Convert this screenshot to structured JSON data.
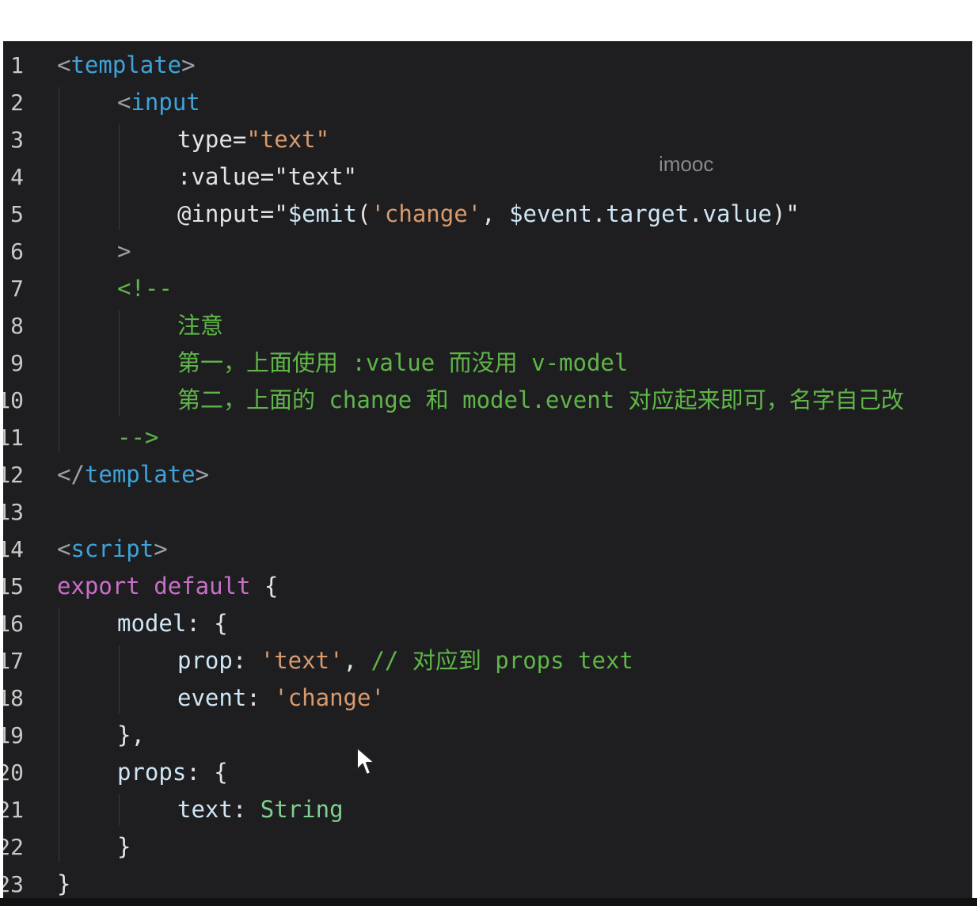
{
  "watermark": "imooc",
  "lines": [
    {
      "num": "1",
      "indent": 0,
      "tokens": [
        {
          "t": "<",
          "c": "punct"
        },
        {
          "t": "template",
          "c": "tag"
        },
        {
          "t": ">",
          "c": "punct"
        }
      ]
    },
    {
      "num": "2",
      "indent": 1,
      "tokens": [
        {
          "t": "<",
          "c": "punct"
        },
        {
          "t": "input",
          "c": "tag"
        }
      ]
    },
    {
      "num": "3",
      "indent": 2,
      "tokens": [
        {
          "t": "type",
          "c": "attr"
        },
        {
          "t": "=",
          "c": "plain"
        },
        {
          "t": "\"text\"",
          "c": "str"
        }
      ]
    },
    {
      "num": "4",
      "indent": 2,
      "tokens": [
        {
          "t": ":value",
          "c": "attr"
        },
        {
          "t": "=",
          "c": "plain"
        },
        {
          "t": "\"text\"",
          "c": "strw"
        }
      ]
    },
    {
      "num": "5",
      "indent": 2,
      "tokens": [
        {
          "t": "@input",
          "c": "attr"
        },
        {
          "t": "=\"",
          "c": "plain"
        },
        {
          "t": "$emit",
          "c": "prop"
        },
        {
          "t": "(",
          "c": "plain"
        },
        {
          "t": "'change'",
          "c": "str"
        },
        {
          "t": ", ",
          "c": "plain"
        },
        {
          "t": "$event.target.value",
          "c": "prop"
        },
        {
          "t": ")\"",
          "c": "plain"
        }
      ]
    },
    {
      "num": "6",
      "indent": 1,
      "tokens": [
        {
          "t": ">",
          "c": "punct"
        }
      ]
    },
    {
      "num": "7",
      "indent": 1,
      "tokens": [
        {
          "t": "<!--",
          "c": "comment"
        }
      ]
    },
    {
      "num": "8",
      "indent": 2,
      "tokens": [
        {
          "t": "注意",
          "c": "comment"
        }
      ]
    },
    {
      "num": "9",
      "indent": 2,
      "tokens": [
        {
          "t": "第一，上面使用 :value 而没用 v-model",
          "c": "comment"
        }
      ]
    },
    {
      "num": "10",
      "indent": 2,
      "tokens": [
        {
          "t": "第二，上面的 change 和 model.event 对应起来即可，名字自己改",
          "c": "comment"
        }
      ]
    },
    {
      "num": "11",
      "indent": 1,
      "tokens": [
        {
          "t": "-->",
          "c": "comment"
        }
      ]
    },
    {
      "num": "12",
      "indent": 0,
      "tokens": [
        {
          "t": "</",
          "c": "punct"
        },
        {
          "t": "template",
          "c": "tag"
        },
        {
          "t": ">",
          "c": "punct"
        }
      ]
    },
    {
      "num": "13",
      "indent": 0,
      "tokens": []
    },
    {
      "num": "14",
      "indent": 0,
      "tokens": [
        {
          "t": "<",
          "c": "punct"
        },
        {
          "t": "script",
          "c": "tag"
        },
        {
          "t": ">",
          "c": "punct"
        }
      ]
    },
    {
      "num": "15",
      "indent": 0,
      "tokens": [
        {
          "t": "export",
          "c": "kw"
        },
        {
          "t": " ",
          "c": "plain"
        },
        {
          "t": "default",
          "c": "kw"
        },
        {
          "t": " {",
          "c": "plain"
        }
      ]
    },
    {
      "num": "16",
      "indent": 1,
      "tokens": [
        {
          "t": "model",
          "c": "prop"
        },
        {
          "t": ": {",
          "c": "plain"
        }
      ]
    },
    {
      "num": "17",
      "indent": 2,
      "tokens": [
        {
          "t": "prop",
          "c": "prop"
        },
        {
          "t": ": ",
          "c": "plain"
        },
        {
          "t": "'text'",
          "c": "str"
        },
        {
          "t": ", ",
          "c": "plain"
        },
        {
          "t": "// 对应到 props text",
          "c": "comment"
        }
      ]
    },
    {
      "num": "18",
      "indent": 2,
      "tokens": [
        {
          "t": "event",
          "c": "prop"
        },
        {
          "t": ": ",
          "c": "plain"
        },
        {
          "t": "'change'",
          "c": "str"
        }
      ]
    },
    {
      "num": "19",
      "indent": 1,
      "tokens": [
        {
          "t": "},",
          "c": "plain"
        }
      ]
    },
    {
      "num": "20",
      "indent": 1,
      "tokens": [
        {
          "t": "props",
          "c": "prop"
        },
        {
          "t": ": {",
          "c": "plain"
        }
      ]
    },
    {
      "num": "21",
      "indent": 2,
      "tokens": [
        {
          "t": "text",
          "c": "prop"
        },
        {
          "t": ": ",
          "c": "plain"
        },
        {
          "t": "String",
          "c": "type"
        }
      ]
    },
    {
      "num": "22",
      "indent": 1,
      "tokens": [
        {
          "t": "}",
          "c": "plain"
        }
      ]
    },
    {
      "num": "23",
      "indent": 0,
      "tokens": [
        {
          "t": "}",
          "c": "plain"
        }
      ]
    }
  ],
  "icons": {
    "cursor": "mouse-pointer-icon"
  },
  "colors": {
    "background": "#1e1e21",
    "tag": "#3ea3d9",
    "string": "#d99a6c",
    "comment": "#5fb648",
    "keyword": "#c86fc7"
  }
}
